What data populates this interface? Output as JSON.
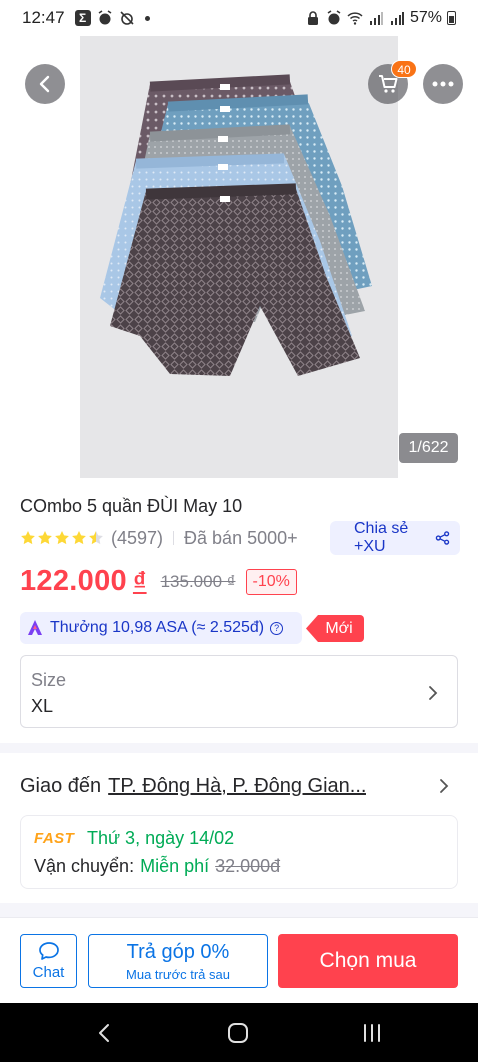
{
  "status_bar": {
    "time": "12:47",
    "battery": "57%",
    "icons": [
      "sigma-icon",
      "alarm-icon",
      "alarm-off-icon",
      "dot-icon",
      "lock-icon",
      "alarm-icon",
      "wifi-icon",
      "signal-icon",
      "signal-icon",
      "battery-icon"
    ]
  },
  "header": {
    "cart_count": "40",
    "image_counter": "1/622"
  },
  "product": {
    "title": "COmbo 5 quần ĐÙI May 10",
    "rating": 4.5,
    "rating_count": "(4597)",
    "sold": "Đã bán 5000+",
    "share_label": "Chia sẻ +XU",
    "price": "122.000",
    "currency": "₫",
    "old_price": "135.000 ₫",
    "discount": "-10%",
    "reward": "Thưởng 10,98 ASA (≈ 2.525đ)",
    "new_tag": "Mới",
    "colors": {
      "price_red": "#ff424e",
      "link_blue": "#1a36c7",
      "green": "#00ab56",
      "fast_orange": "#ffa31a"
    }
  },
  "size": {
    "label": "Size",
    "value": "XL"
  },
  "delivery": {
    "label": "Giao đến",
    "address": "TP. Đông Hà, P. Đông Gian...",
    "fast_logo": "FAST",
    "date": "Thứ 3, ngày 14/02",
    "shipping_label": "Vận chuyển:",
    "shipping_value": "Miễn phí",
    "shipping_old": "32.000đ"
  },
  "actions": {
    "chat": "Chat",
    "installment": "Trả góp 0%",
    "installment_sub": "Mua trước trả sau",
    "buy": "Chọn mua"
  }
}
